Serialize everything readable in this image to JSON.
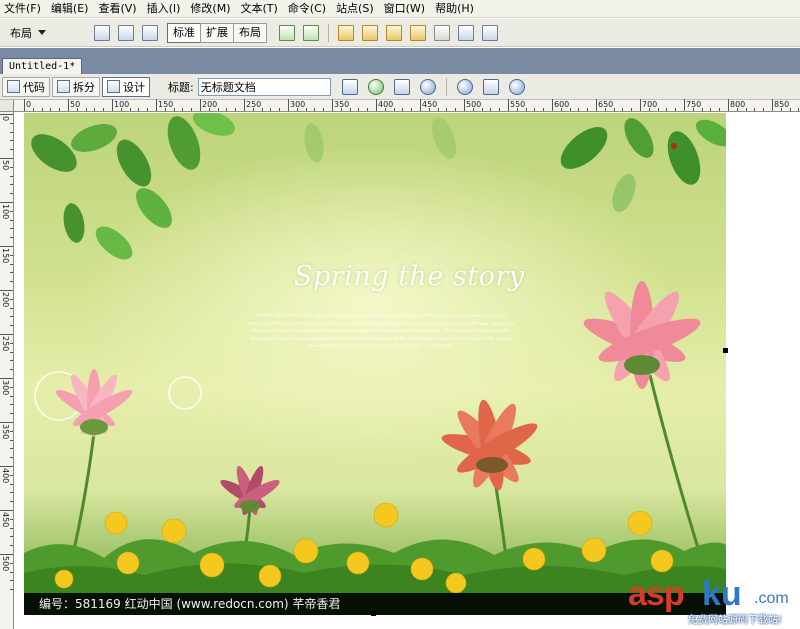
{
  "menubar": {
    "items": [
      "文件(F)",
      "编辑(E)",
      "查看(V)",
      "插入(I)",
      "修改(M)",
      "文本(T)",
      "命令(C)",
      "站点(S)",
      "窗口(W)",
      "帮助(H)"
    ]
  },
  "insertbar": {
    "layout_label": "布局",
    "mode_buttons": [
      "标准",
      "扩展",
      "布局"
    ]
  },
  "document": {
    "tab_title": "Untitled-1*",
    "view_buttons": [
      "代码",
      "拆分",
      "设计"
    ],
    "title_label": "标题:",
    "title_value": "无标题文档"
  },
  "ruler": {
    "h_labels": [
      "0",
      "50",
      "100",
      "150",
      "200",
      "250",
      "300",
      "350",
      "400",
      "450",
      "500",
      "550",
      "600",
      "650",
      "700",
      "750",
      "800",
      "850"
    ],
    "v_labels": [
      "0",
      "50",
      "100",
      "150",
      "200",
      "250",
      "300",
      "350",
      "400",
      "450",
      "500"
    ]
  },
  "artwork": {
    "title": "Spring the story",
    "paragraph": "PUNIC INSTINCT, INC. started its business in Seoul Korea in February 1993 with the fundamental goal of providing better internet services to the world. PUNIC stands for the \"morning land\" in ancient Korean. Hoping to become the world's leading web designers, programmers, and service engineers. The Cultural Foundation, Mr. Noh studied game theory and statistics in the Ph.D. program at the University of Rochester in New York. Sophia was originated from Korea but the eyes are open to the world.",
    "caption": "编号：581169    红动中国 (www.redocn.com)    芊帝香君"
  },
  "watermark": {
    "brand_red": "asp",
    "brand_blue": "ku",
    "suffix": ".com",
    "tagline": "免费网站源码下载站!"
  },
  "colors": {
    "chrome": "#ecebe3",
    "tabstrip": "#7b8aa3",
    "brand_red": "#d63b2b",
    "brand_blue": "#2f78c8"
  }
}
